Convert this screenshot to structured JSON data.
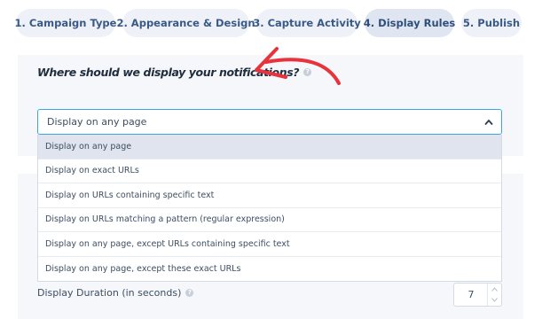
{
  "tabs": [
    {
      "label": "1. Campaign Type"
    },
    {
      "label": "2. Appearance & Design"
    },
    {
      "label": "3. Capture Activity"
    },
    {
      "label": "4. Display Rules",
      "active": true
    },
    {
      "label": "5. Publish"
    }
  ],
  "display_rules": {
    "question": "Where should we display your notifications?",
    "select": {
      "value": "Display on any page",
      "options": [
        "Display on any page",
        "Display on exact URLs",
        "Display on URLs containing specific text",
        "Display on URLs matching a pattern (regular expression)",
        "Display on any page, except URLs containing specific text",
        "Display on any page, except these exact URLs"
      ]
    }
  },
  "duration": {
    "label": "Display Duration (in seconds)",
    "value": "7"
  },
  "colors": {
    "focus_border": "#3aa6e8",
    "annotation_arrow": "#e8323c",
    "tab_text": "#3a5a85"
  },
  "icons": [
    "help-icon",
    "chevron-up-icon",
    "arrow-annotation",
    "increment-icon",
    "decrement-icon"
  ]
}
